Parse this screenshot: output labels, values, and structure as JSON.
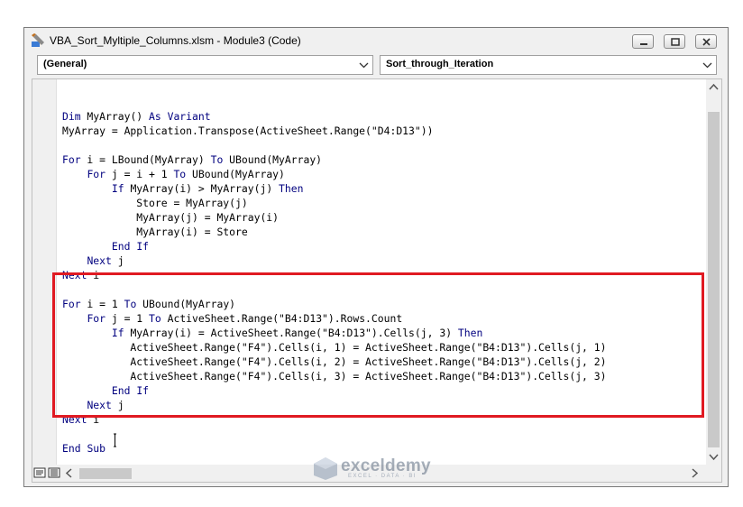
{
  "window": {
    "title": "VBA_Sort_Myltiple_Columns.xlsm - Module3 (Code)"
  },
  "combos": {
    "object": "(General)",
    "procedure": "Sort_through_Iteration"
  },
  "code": [
    "",
    "Dim MyArray() As Variant",
    "MyArray = Application.Transpose(ActiveSheet.Range(\"D4:D13\"))",
    "",
    "For i = LBound(MyArray) To UBound(MyArray)",
    "    For j = i + 1 To UBound(MyArray)",
    "        If MyArray(i) > MyArray(j) Then",
    "            Store = MyArray(j)",
    "            MyArray(j) = MyArray(i)",
    "            MyArray(i) = Store",
    "        End If",
    "    Next j",
    "Next i",
    "",
    "For i = 1 To UBound(MyArray)",
    "    For j = 1 To ActiveSheet.Range(\"B4:D13\").Rows.Count",
    "        If MyArray(i) = ActiveSheet.Range(\"B4:D13\").Cells(j, 3) Then",
    "           ActiveSheet.Range(\"F4\").Cells(i, 1) = ActiveSheet.Range(\"B4:D13\").Cells(j, 1)",
    "           ActiveSheet.Range(\"F4\").Cells(i, 2) = ActiveSheet.Range(\"B4:D13\").Cells(j, 2)",
    "           ActiveSheet.Range(\"F4\").Cells(i, 3) = ActiveSheet.Range(\"B4:D13\").Cells(j, 3)",
    "        End If",
    "    Next j",
    "Next i",
    "",
    "End Sub"
  ],
  "watermark": {
    "name": "exceldemy",
    "tagline": "EXCEL · DATA · BI"
  },
  "colors": {
    "keyword": "#00007f",
    "highlight_border": "#e01a22",
    "text": "#000000"
  },
  "icons": {
    "title": "vba-module-icon",
    "minimize": "minimize-icon",
    "restore": "restore-icon",
    "close": "close-icon",
    "dropdown": "chevron-down-icon",
    "procedure_view": "procedure-view-icon",
    "module_view": "full-module-view-icon"
  }
}
